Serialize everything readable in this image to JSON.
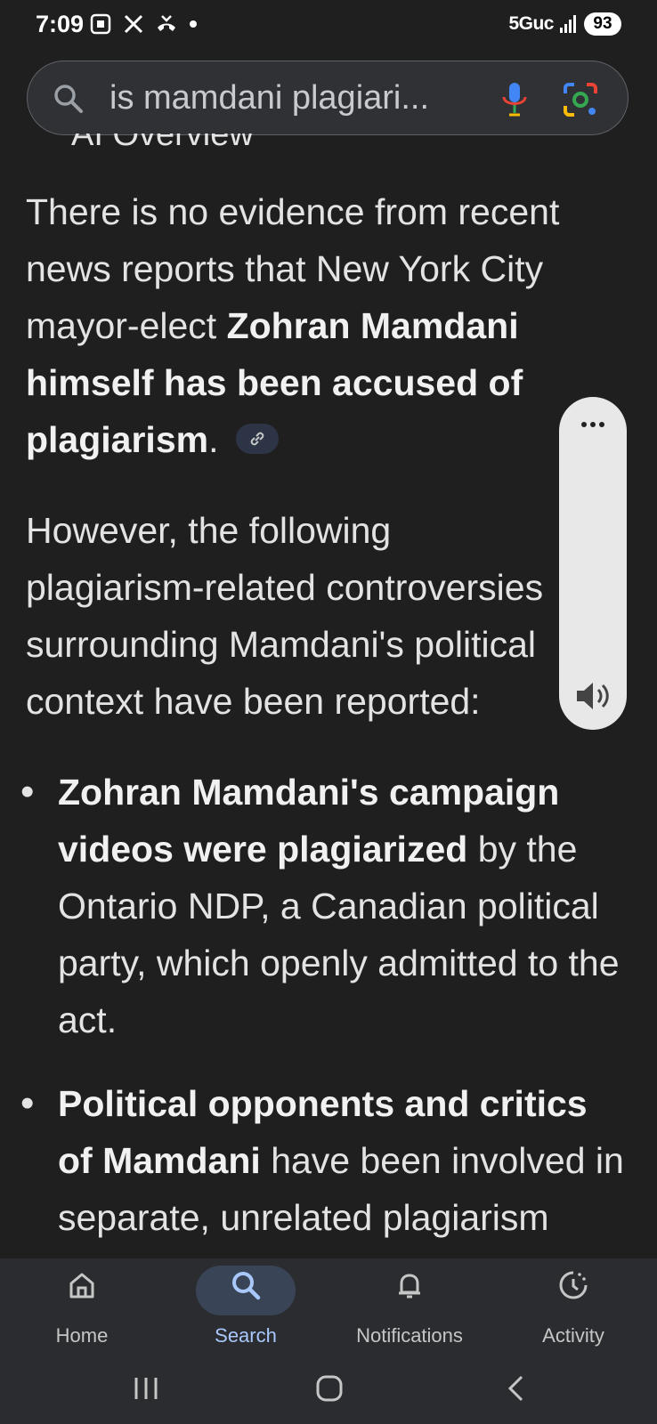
{
  "status_bar": {
    "time": "7:09",
    "network": "5Guc",
    "battery": "93"
  },
  "search": {
    "query": "is mamdani plagiari...",
    "icons": [
      "search-icon",
      "mic-icon",
      "lens-icon"
    ]
  },
  "content": {
    "partial_header": "AI Overview",
    "para1": {
      "normal1": "There is no evidence from recent news reports that New York City mayor-elect ",
      "bold1": "Zohran Mamdani himself has been accused of plagiarism",
      "normal2": "."
    },
    "para2": "However, the following plagiarism-related controversies surrounding Mamdani's political context have been reported:",
    "bullets": [
      {
        "bold": "Zohran Mamdani's campaign videos were plagiarized",
        "text": " by the Ontario NDP, a Canadian political party, which openly admitted to the act."
      },
      {
        "bold": "Political opponents and critics of Mamdani",
        "text": " have been involved in separate, unrelated plagiarism"
      }
    ]
  },
  "float_panel": {
    "icons": [
      "more-icon",
      "speaker-icon"
    ]
  },
  "bottom_nav": {
    "items": [
      {
        "label": "Home",
        "icon": "home-icon"
      },
      {
        "label": "Search",
        "icon": "search-icon",
        "active": true
      },
      {
        "label": "Notifications",
        "icon": "bell-icon"
      },
      {
        "label": "Activity",
        "icon": "activity-icon"
      }
    ]
  },
  "colors": {
    "background": "#1f1f1f",
    "text": "#e3e3e3",
    "active_nav": "#a8c7fa",
    "active_pill": "#394457"
  }
}
